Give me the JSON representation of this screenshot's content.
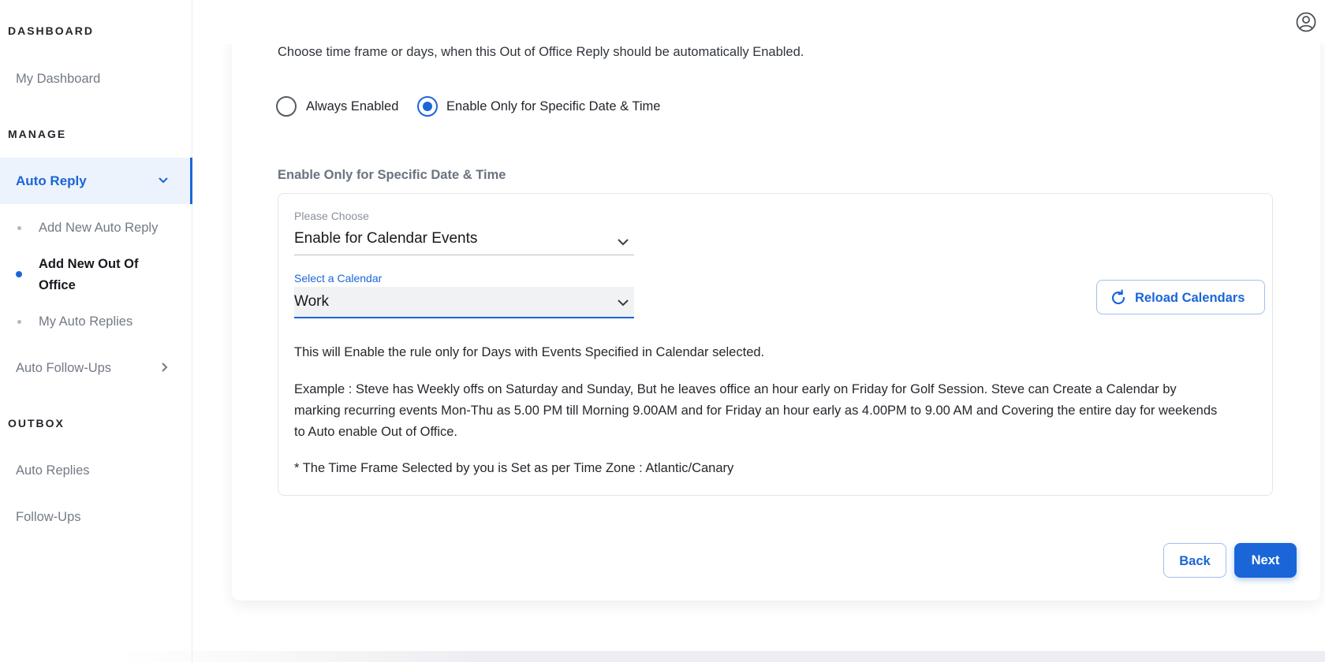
{
  "sidebar": {
    "dashboard_title": "DASHBOARD",
    "my_dashboard": "My Dashboard",
    "manage_title": "MANAGE",
    "auto_reply": "Auto Reply",
    "sub_items": [
      "Add New Auto Reply",
      "Add New Out Of Office",
      "My Auto Replies"
    ],
    "auto_follow_ups": "Auto Follow-Ups",
    "outbox_title": "OUTBOX",
    "auto_replies": "Auto Replies",
    "follow_ups": "Follow-Ups"
  },
  "main": {
    "intro": "Choose time frame or days, when this Out of Office Reply should be automatically Enabled.",
    "radio_options": [
      "Always Enabled",
      "Enable Only for Specific Date & Time"
    ],
    "selected_radio": "Enable Only for Specific Date & Time",
    "section_heading": "Enable Only for Specific Date & Time",
    "choose_label": "Please Choose",
    "choose_value": "Enable for Calendar Events",
    "calendar_label": "Select a Calendar",
    "calendar_value": "Work",
    "reload_label": "Reload Calendars",
    "info_text": "This will Enable the rule only for Days with Events Specified in Calendar selected.",
    "example_text": "Example : Steve has Weekly offs on Saturday and Sunday, But he leaves office an hour early on Friday for Golf Session. Steve can Create a Calendar by marking recurring events Mon-Thu as 5.00 PM till Morning 9.00AM and for Friday an hour early as 4.00PM to 9.00 AM and Covering the entire day for weekends to Auto enable Out of Office.",
    "timezone_text": "* The Time Frame Selected by you is Set as per Time Zone : Atlantic/Canary",
    "back_label": "Back",
    "next_label": "Next"
  },
  "colors": {
    "accent": "#1a66d8",
    "active_bg": "#edf3fc"
  }
}
